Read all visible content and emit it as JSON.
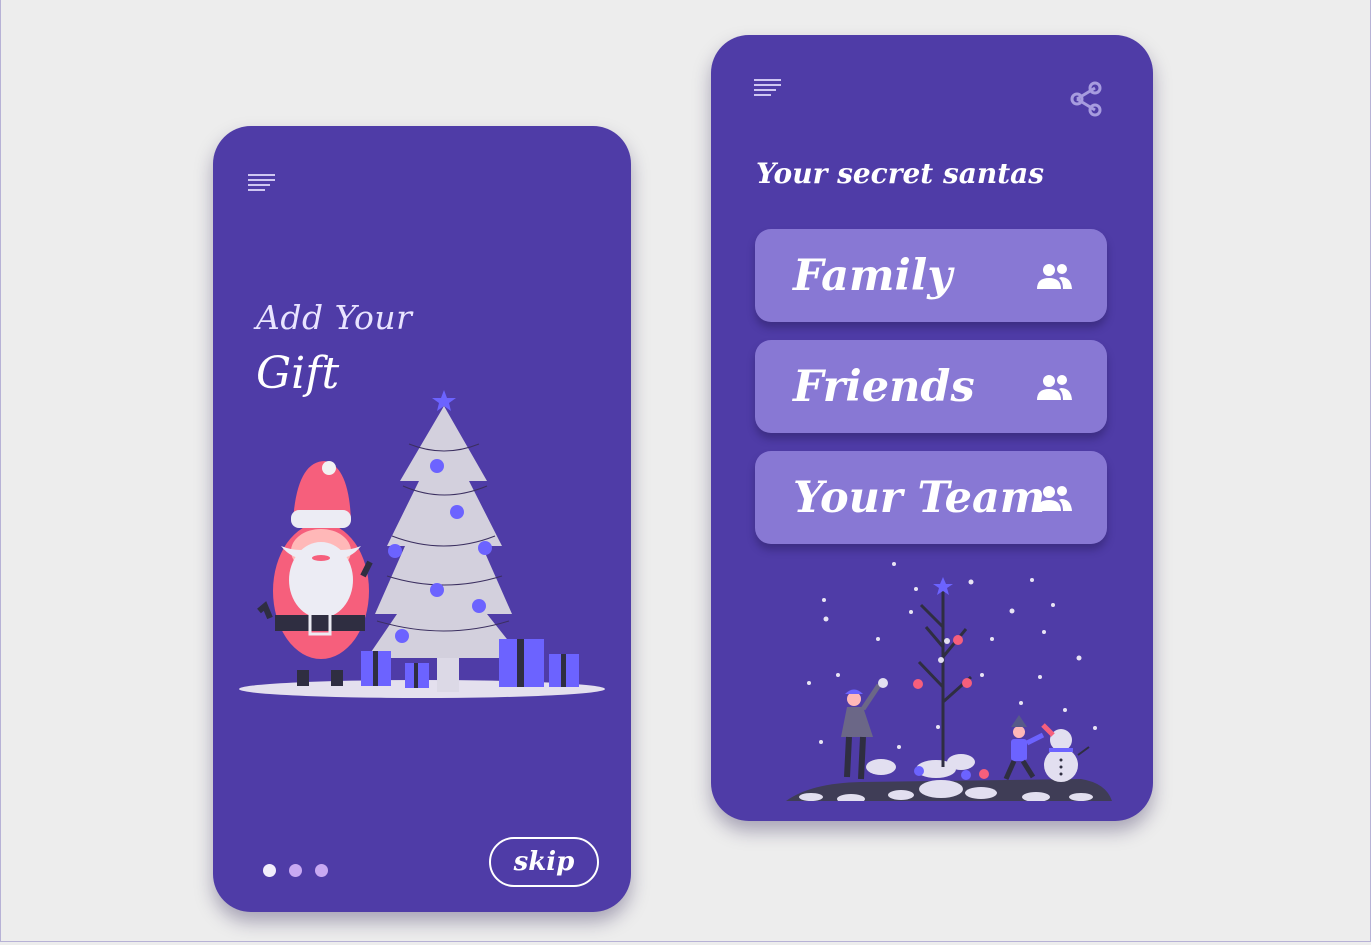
{
  "onboarding": {
    "title_line1": "Add Your",
    "title_line2": "Gift",
    "skip_label": "skip",
    "page_dots": [
      {
        "state": "active",
        "color": "#f2eefc"
      },
      {
        "state": "inactive",
        "color": "#c8a9f2"
      },
      {
        "state": "inactive",
        "color": "#c8a9f2"
      }
    ],
    "menu_icon": "menu-icon",
    "illustration": "santa-christmas-tree-gifts"
  },
  "santas": {
    "title": "Your secret santas",
    "menu_icon": "menu-icon",
    "share_icon": "share-icon",
    "groups": [
      {
        "label": "Family",
        "icon": "people-icon"
      },
      {
        "label": "Friends",
        "icon": "people-icon"
      },
      {
        "label": "Your Team",
        "icon": "people-icon"
      }
    ],
    "illustration": "kids-snowman-winter-tree"
  },
  "colors": {
    "background": "#ededed",
    "phone": "#4f3ca7",
    "card": "#8878d4",
    "accent": "#6c63ff",
    "santa_red": "#f65f7c"
  }
}
